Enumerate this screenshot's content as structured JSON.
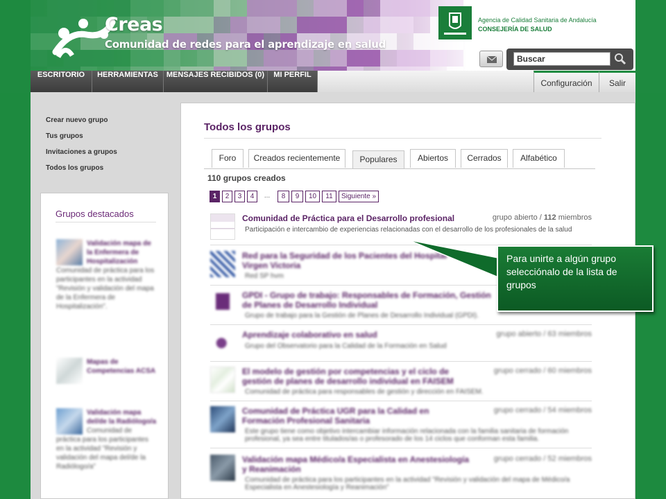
{
  "header": {
    "brand_title": "Creas",
    "brand_subtitle": "Comunidad de redes para el aprendizaje en salud",
    "agency_line1": "Agencia de Calidad Sanitaria de Andalucía",
    "agency_line2": "CONSEJERÍA DE SALUD",
    "search_placeholder": "Buscar",
    "mail_icon": "mail-icon",
    "search_icon": "magnifier-icon"
  },
  "nav": {
    "items": [
      "ESCRITORIO",
      "HERRAMIENTAS",
      "MENSAJES RECIBIDOS (0)",
      "MI PERFIL"
    ],
    "right_items": [
      "Configuración",
      "Salir"
    ]
  },
  "sidebar": {
    "links": [
      "Crear nuevo grupo",
      "Tus grupos",
      "Invitaciones a grupos",
      "Todos los grupos"
    ],
    "featured_title": "Grupos destacados",
    "featured": [
      {
        "title": "Validación mapa de la Enfermera de Hospitalización",
        "desc": "Comunidad de práctica para los participantes en la actividad \"Revisión y validación del mapa de la Enfermera de Hospitalización\"."
      },
      {
        "title": "Mapas de Competencias ACSA",
        "desc": ""
      },
      {
        "title": "Validación mapa del/de la Radiólogo/a",
        "desc": "Comunidad de práctica para los participantes en la actividad \"Revisión y validación del mapa del/de la Radiólogo/a\""
      }
    ]
  },
  "main": {
    "title": "Todos los grupos",
    "tabs": [
      "Foro",
      "Creados recientemente",
      "Populares",
      "Abiertos",
      "Cerrados",
      "Alfabético"
    ],
    "active_tab": "Populares",
    "count": "110 grupos creados",
    "pager": [
      "1",
      "2",
      "3",
      "4",
      "...",
      "8",
      "9",
      "10",
      "11",
      "Siguiente »"
    ],
    "groups": [
      {
        "title": "Comunidad de Práctica para el Desarrollo profesional",
        "meta": "grupo abierto / ",
        "meta_num": "112",
        "meta_tail": " miembros",
        "desc": "Participación e intercambio de experiencias relacionadas con el desarrollo de los profesionales de la salud"
      },
      {
        "title": "Red para la Seguridad de los Pacientes del Hospital Virgen Victoria",
        "meta": "",
        "desc": "Red SP hvm"
      },
      {
        "title": "GPDI - Grupo de trabajo: Responsables de Formación, Gestión de Planes de Desarrollo Individual",
        "meta": "",
        "desc": "Grupo de trabajo para la Gestión de Planes de Desarrollo Individual (GPDI)."
      },
      {
        "title": "Aprendizaje colaborativo en salud",
        "meta": "grupo abierto / 63 miembros",
        "desc": "Grupo del Observatorio para la Calidad de la Formación en Salud"
      },
      {
        "title": "El modelo de gestión por competencias y el ciclo de gestión de planes de desarrollo individual en FAISEM",
        "meta": "grupo cerrado / 60 miembros",
        "desc": "Comunidad de práctica para responsables de gestión y dirección en FAISEM."
      },
      {
        "title": "Comunidad de Práctica UGR para la Calidad en Formación Profesional Sanitaria",
        "meta": "grupo cerrado / 54 miembros",
        "desc": "Este grupo tiene como objetivo intercambiar información relacionada con la familia sanitaria de formación profesional, ya sea entre titulados/as o profesorado de los 14 ciclos que conforman esta familia."
      },
      {
        "title": "Validación mapa Médico/a Especialista en Anestesiología y Reanimación",
        "meta": "grupo cerrado / 52 miembros",
        "desc": "Comunidad de práctica para los participantes en la actividad \"Revisión y validación del mapa de Médico/a Especialista en Anestesiología y Reanimación\""
      }
    ]
  },
  "callout": {
    "text": "Para unirte a algún grupo selecciónalo de la lista de grupos"
  },
  "colors": {
    "brand_green": "#1e8a40",
    "brand_purple": "#5b2466"
  }
}
